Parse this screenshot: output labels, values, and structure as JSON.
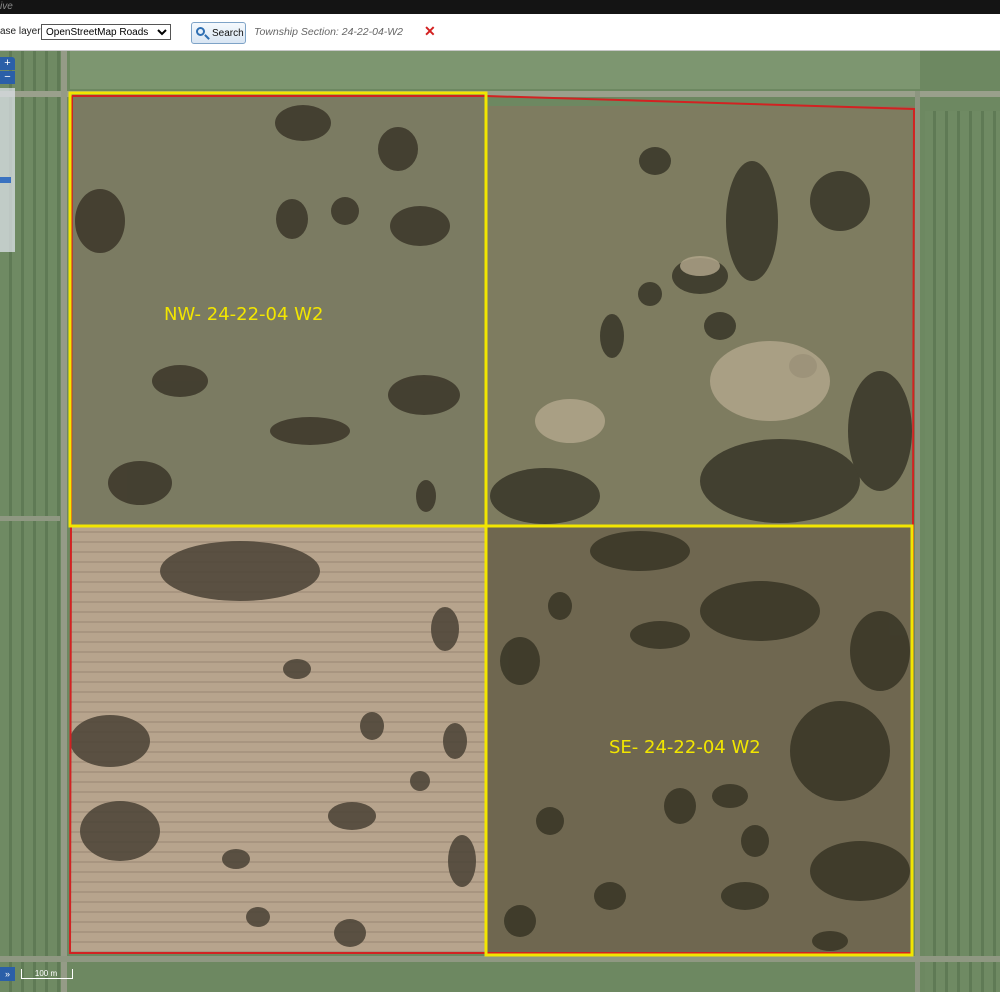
{
  "topbar": {
    "text": "ive"
  },
  "toolbar": {
    "base_layer_label": "ase layer:",
    "base_layer_value": "OpenStreetMap Roads",
    "search_label": "Search",
    "township_label": "Township Section: 24-22-04-W2"
  },
  "map": {
    "quarters": [
      {
        "label": "NW- 24-22-04 W2"
      },
      {
        "label": "SE- 24-22-04 W2"
      }
    ],
    "scale_label": "100 m",
    "zoom_in": "+",
    "zoom_out": "−",
    "expand": "»"
  },
  "colors": {
    "quarter_outline": "#f2e600",
    "section_outline": "#d22222"
  },
  "icons": [
    "search-icon",
    "close-icon",
    "zoom-in-icon",
    "zoom-out-icon",
    "expand-icon"
  ]
}
